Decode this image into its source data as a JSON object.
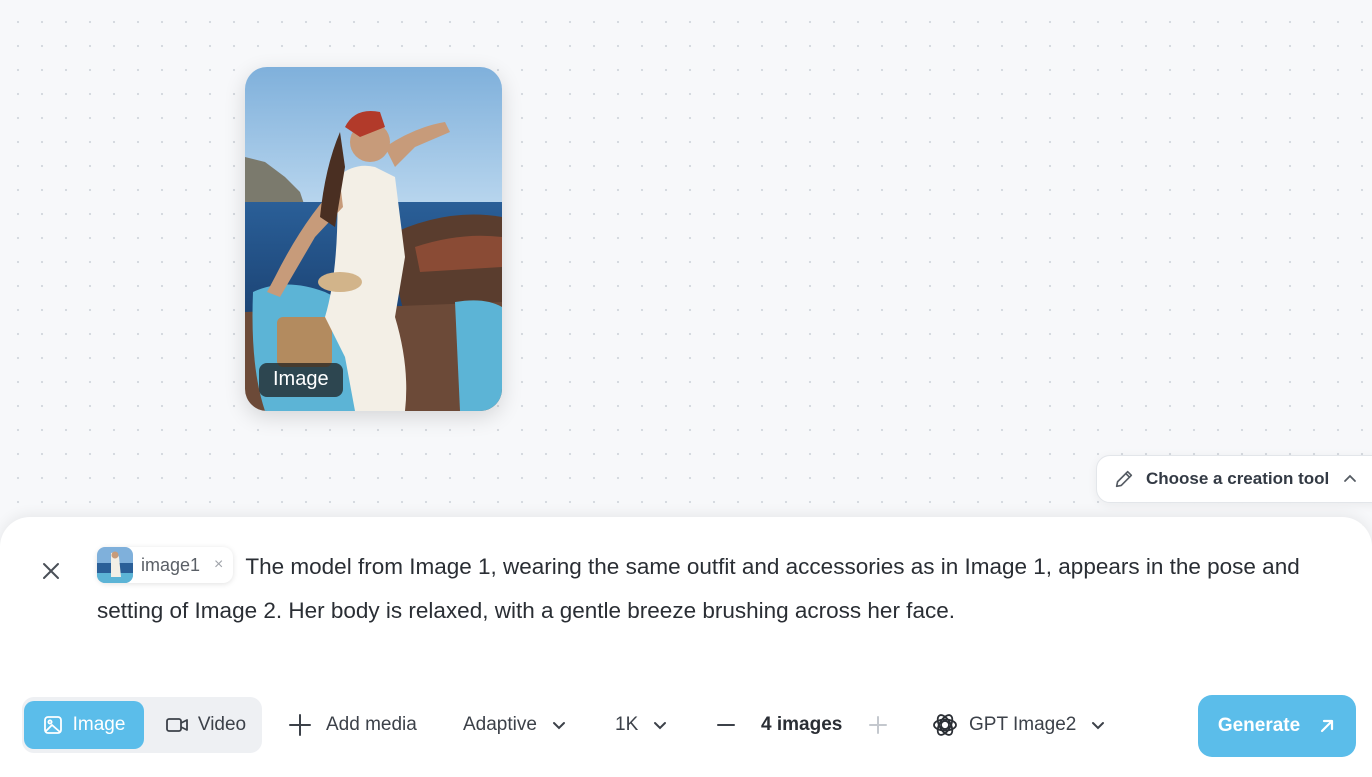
{
  "canvas": {
    "node": {
      "label": "Image"
    }
  },
  "tool_chooser": {
    "label": "Choose a creation tool",
    "icon": "pencil-icon"
  },
  "composer": {
    "attachment": {
      "label": "image1",
      "remove": "×"
    },
    "prompt": "The model from Image 1, wearing the same outfit and accessories as in Image 1, appears in the pose and setting of Image 2. Her body is relaxed, with a gentle breeze brushing across her face."
  },
  "toolbar": {
    "modes": [
      {
        "label": "Image",
        "icon": "image-icon",
        "active": true
      },
      {
        "label": "Video",
        "icon": "video-icon",
        "active": false
      }
    ],
    "add_media": "Add media",
    "aspect": "Adaptive",
    "resolution": "1K",
    "count": "4 images",
    "model": "GPT Image2",
    "generate": "Generate"
  },
  "colors": {
    "accent": "#5bbdea",
    "background": "#f7f8fa"
  }
}
